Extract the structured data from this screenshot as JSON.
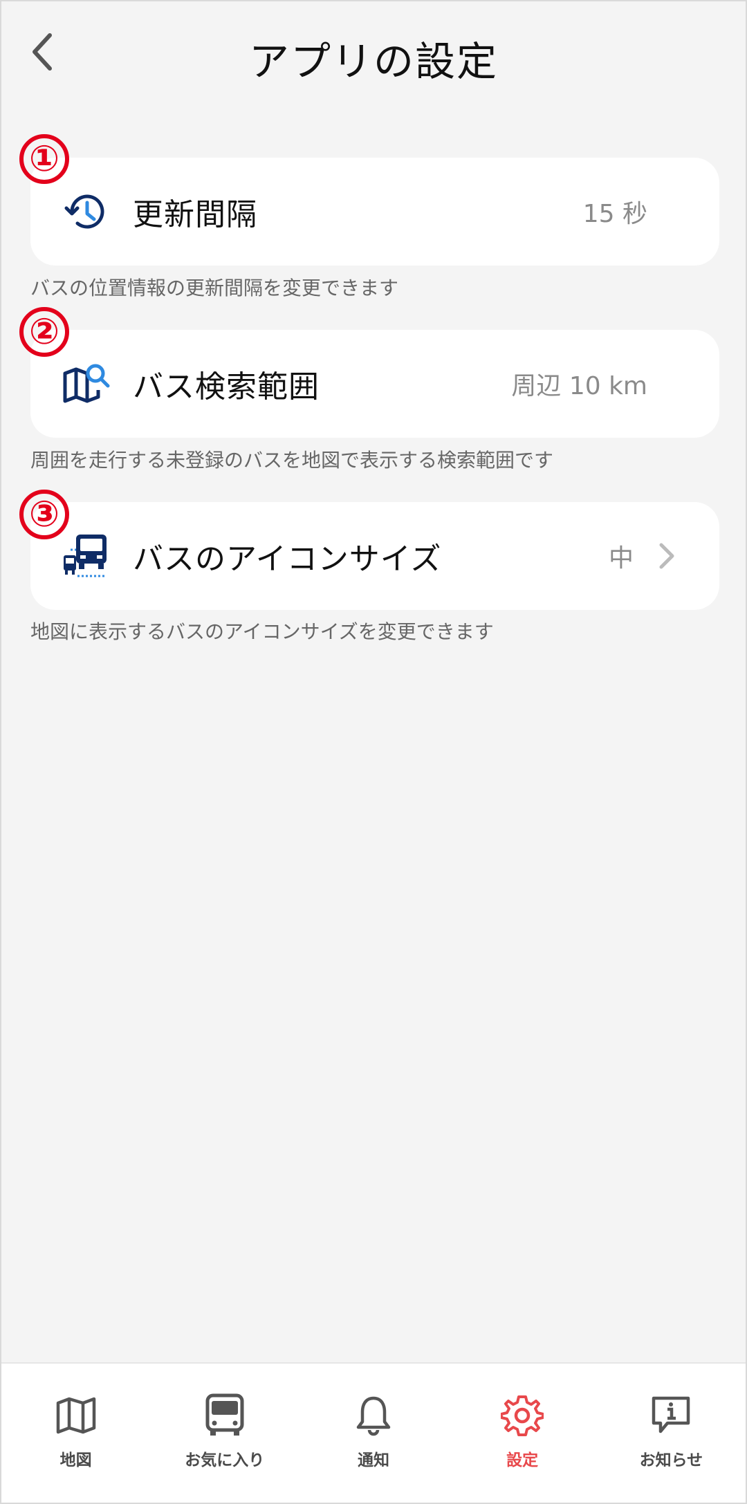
{
  "header": {
    "title": "アプリの設定"
  },
  "markers": [
    "①",
    "②",
    "③"
  ],
  "settings": [
    {
      "label": "更新間隔",
      "value": "15 秒",
      "description": "バスの位置情報の更新間隔を変更できます",
      "icon": "history-clock-icon"
    },
    {
      "label": "バス検索範囲",
      "value": "周辺 10 km",
      "description": "周囲を走行する未登録のバスを地図で表示する検索範囲です",
      "icon": "map-search-icon"
    },
    {
      "label": "バスのアイコンサイズ",
      "value": "中",
      "description": "地図に表示するバスのアイコンサイズを変更できます",
      "icon": "bus-size-icon"
    }
  ],
  "nav": {
    "items": [
      {
        "label": "地図",
        "icon": "map-icon"
      },
      {
        "label": "お気に入り",
        "icon": "bus-icon"
      },
      {
        "label": "通知",
        "icon": "bell-icon"
      },
      {
        "label": "設定",
        "icon": "gear-icon",
        "active": true
      },
      {
        "label": "お知らせ",
        "icon": "info-chat-icon"
      }
    ]
  },
  "colors": {
    "accent": "#e8484b",
    "marker": "#e3001b",
    "icon_navy": "#0f2c66",
    "icon_blue": "#2f8ae0"
  }
}
